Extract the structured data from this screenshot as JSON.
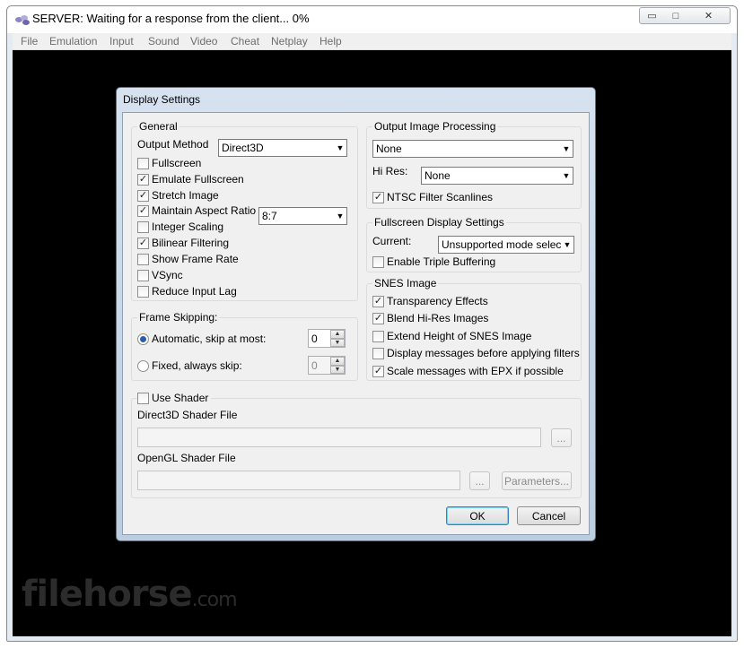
{
  "window": {
    "title": "SERVER: Waiting for a response from the client...  0%",
    "minimize_glyph": "▭",
    "maximize_glyph": "□",
    "close_glyph": "✕"
  },
  "menu": [
    "File",
    "Emulation",
    "Input",
    "Sound",
    "Video",
    "Cheat",
    "Netplay",
    "Help"
  ],
  "watermark": {
    "main": "filehorse",
    "suffix": ".com"
  },
  "dialog": {
    "title": "Display Settings",
    "general": {
      "title": "General",
      "output_method_label": "Output Method",
      "output_method_value": "Direct3D",
      "aspect_value": "8:7",
      "options": [
        {
          "label": "Fullscreen",
          "checked": false
        },
        {
          "label": "Emulate Fullscreen",
          "checked": true
        },
        {
          "label": "Stretch Image",
          "checked": true
        },
        {
          "label": "Maintain Aspect Ratio",
          "checked": true
        },
        {
          "label": "Integer Scaling",
          "checked": false
        },
        {
          "label": "Bilinear Filtering",
          "checked": true
        },
        {
          "label": "Show Frame Rate",
          "checked": false
        },
        {
          "label": "VSync",
          "checked": false
        },
        {
          "label": "Reduce Input Lag",
          "checked": false
        }
      ]
    },
    "frame_skipping": {
      "title": "Frame Skipping:",
      "auto_label": "Automatic, skip at most:",
      "auto_value": "0",
      "fixed_label": "Fixed, always skip:",
      "fixed_value": "0"
    },
    "output_processing": {
      "title": "Output Image Processing",
      "filter_value": "None",
      "hires_label": "Hi Res:",
      "hires_value": "None",
      "ntsc_label": "NTSC Filter Scanlines",
      "ntsc_checked": true
    },
    "fullscreen_settings": {
      "title": "Fullscreen Display Settings",
      "current_label": "Current:",
      "current_value": "Unsupported mode selected",
      "triple_label": "Enable Triple Buffering",
      "triple_checked": false
    },
    "snes_image": {
      "title": "SNES Image",
      "options": [
        {
          "label": "Transparency Effects",
          "checked": true
        },
        {
          "label": "Blend Hi-Res Images",
          "checked": true
        },
        {
          "label": "Extend Height of SNES Image",
          "checked": false
        },
        {
          "label": "Display messages before applying filters",
          "checked": false
        },
        {
          "label": "Scale messages with EPX if possible",
          "checked": true
        }
      ]
    },
    "shader": {
      "use_label": "Use Shader",
      "use_checked": false,
      "d3d_label": "Direct3D Shader File",
      "opengl_label": "OpenGL Shader File",
      "browse_label": "...",
      "parameters_label": "Parameters..."
    },
    "ok_label": "OK",
    "cancel_label": "Cancel"
  }
}
